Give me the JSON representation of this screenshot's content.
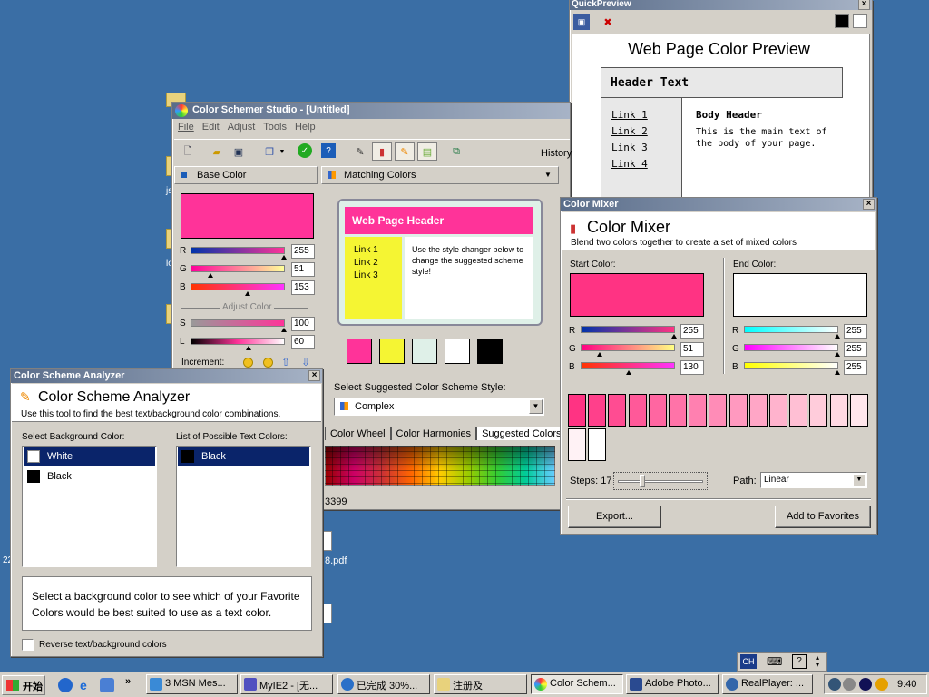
{
  "desktop": {
    "icon_texts": [
      "22",
      "8.pdf",
      "js",
      "lo",
      "r"
    ]
  },
  "studio": {
    "title": "Color Schemer Studio - [Untitled]",
    "menu": [
      "File",
      "Edit",
      "Adjust",
      "Tools",
      "Help"
    ],
    "history_label": "History",
    "base_color": {
      "panel_title": "Base Color",
      "swatch": "#ff3399",
      "r_label": "R",
      "r": "255",
      "g_label": "G",
      "g": "51",
      "b_label": "B",
      "b": "153",
      "adjust_label": "Adjust Color",
      "s_label": "S",
      "s": "100",
      "l_label": "L",
      "l": "60",
      "increment_label": "Increment:"
    },
    "matching": {
      "panel_title": "Matching Colors",
      "preview_header": "Web Page Header",
      "links": [
        "Link 1",
        "Link 2",
        "Link 3"
      ],
      "preview_text": "Use the style changer below to change the suggested scheme style!",
      "swatches": [
        "#ff3399",
        "#f5f533",
        "#dff0e8",
        "#ffffff",
        "#000000"
      ],
      "style_label": "Select Suggested Color Scheme Style:",
      "style_value": "Complex",
      "tabs": [
        "Color Wheel",
        "Color Harmonies",
        "Suggested Colors"
      ],
      "hex_value": "3399"
    }
  },
  "quickpreview": {
    "title": "QuickPreview",
    "page_title": "Web Page Color Preview",
    "header_text": "Header Text",
    "links": [
      "Link 1",
      "Link 2",
      "Link 3",
      "Link 4"
    ],
    "body_header": "Body Header",
    "body_text": "This is the main text of the body of your page."
  },
  "mixer": {
    "title": "Color Mixer",
    "heading": "Color Mixer",
    "subtitle": "Blend two colors together to create a set of mixed colors",
    "start_label": "Start Color:",
    "end_label": "End Color:",
    "start_color": "#ff3383",
    "end_color": "#ffffff",
    "start": {
      "r": "255",
      "g": "51",
      "b": "130"
    },
    "end": {
      "r": "255",
      "g": "255",
      "b": "255"
    },
    "channel_labels": [
      "R",
      "G",
      "B"
    ],
    "steps_label": "Steps: 17",
    "path_label": "Path:",
    "path_value": "Linear",
    "export_label": "Export...",
    "favorites_label": "Add to Favorites",
    "mixed_colors": [
      "#ff3383",
      "#ff408b",
      "#ff4c92",
      "#ff5999",
      "#ff66a1",
      "#ff73a8",
      "#ff80b0",
      "#ff8cb7",
      "#ff99bf",
      "#ffa6c6",
      "#ffb3cd",
      "#ffbfd4",
      "#ffccdb",
      "#ffd9e3",
      "#ffe6ec",
      "#fff2f5",
      "#ffffff"
    ]
  },
  "analyzer": {
    "title": "Color Scheme Analyzer",
    "heading": "Color Scheme Analyzer",
    "subtitle": "Use this tool to find the best text/background color combinations.",
    "bg_label": "Select Background Color:",
    "text_label": "List of Possible Text Colors:",
    "bg_items": [
      {
        "name": "White",
        "color": "#ffffff"
      },
      {
        "name": "Black",
        "color": "#000000"
      }
    ],
    "text_items": [
      {
        "name": "Black",
        "color": "#000000"
      }
    ],
    "info_text": "Select a background color to see which of your Favorite Colors would be best suited to use as a text color.",
    "reverse_label": "Reverse text/background colors"
  },
  "taskbar": {
    "start_label": "开始",
    "tray_lang": "CH",
    "clock": "9:40",
    "buttons": [
      "3 MSN Mes...",
      "MyIE2 - [无...",
      "已完成 30%...",
      "注册及",
      "Color Schem...",
      "Adobe Photo...",
      "RealPlayer: ..."
    ]
  }
}
